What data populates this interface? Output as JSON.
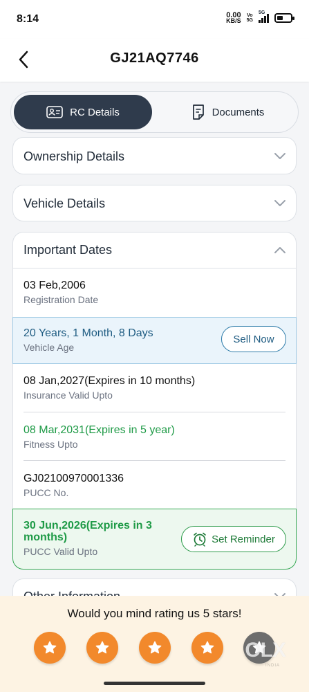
{
  "status_bar": {
    "time": "8:14",
    "net_speed_value": "0.00",
    "net_speed_unit": "KB/S",
    "volte_top": "Vo",
    "volte_bottom": "5G",
    "network_type": "5G",
    "battery_level_percent": 45
  },
  "header": {
    "title": "GJ21AQ7746",
    "back_icon": "chevron-left-icon"
  },
  "tabs": [
    {
      "label": "RC Details",
      "icon": "id-card-icon",
      "active": true
    },
    {
      "label": "Documents",
      "icon": "document-icon",
      "active": false
    }
  ],
  "sections": {
    "ownership": {
      "title": "Ownership Details",
      "expanded": false
    },
    "vehicle": {
      "title": "Vehicle Details",
      "expanded": false
    },
    "important_dates": {
      "title": "Important Dates",
      "expanded": true,
      "registration": {
        "value": "03 Feb,2006",
        "label": "Registration Date"
      },
      "vehicle_age": {
        "value": "20 Years, 1 Month, 8 Days",
        "label": "Vehicle Age",
        "action": "Sell Now"
      },
      "insurance": {
        "value": "08 Jan,2027(Expires in 10 months)",
        "label": "Insurance Valid Upto"
      },
      "fitness": {
        "value": "08 Mar,2031(Expires in 5 year)",
        "label": "Fitness Upto"
      },
      "pucc_no": {
        "value": "GJ02100970001336",
        "label": "PUCC No."
      },
      "pucc_valid": {
        "value_line1": "30 Jun,2026(Expires in 3",
        "value_line2": "months)",
        "label": "PUCC Valid Upto",
        "action": "Set Reminder"
      }
    },
    "other": {
      "title": "Other Information",
      "expanded": false
    }
  },
  "rating": {
    "prompt": "Would you mind rating us 5 stars!",
    "stars": 5,
    "watermark": "OLX",
    "watermark_sub": "INDIA"
  },
  "colors": {
    "active_tab_bg": "#2f3b4c",
    "age_highlight_bg": "#eaf4fb",
    "age_text": "#1f5c82",
    "green_text": "#1e9a46",
    "pucc_highlight_bg": "#edf8ef",
    "star_orange": "#f2892c",
    "rating_panel_bg": "#fdf3e3"
  }
}
